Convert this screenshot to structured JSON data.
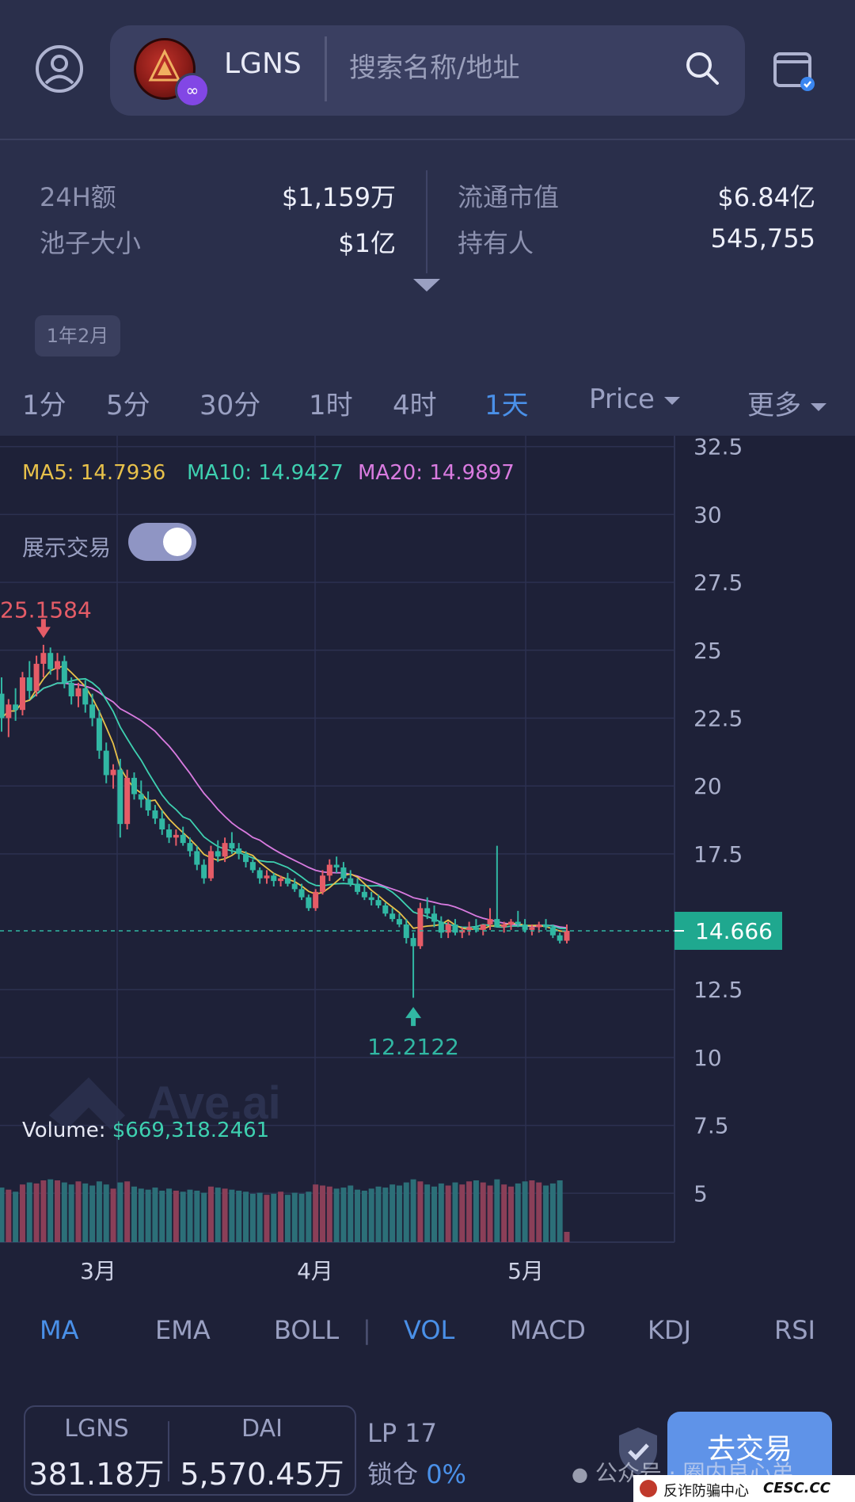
{
  "header": {
    "token_symbol": "LGNS",
    "search_placeholder": "搜索名称/地址",
    "chain_badge": "∞"
  },
  "stats": {
    "vol24h_label": "24H额",
    "vol24h_value": "$1,159万",
    "pool_label": "池子大小",
    "pool_value": "$1亿",
    "mcap_label": "流通市值",
    "mcap_value": "$6.84亿",
    "holders_label": "持有人",
    "holders_value": "545,755"
  },
  "range_chip": "1年2月",
  "timeframes": [
    "1分",
    "5分",
    "30分",
    "1时",
    "4时",
    "1天"
  ],
  "active_timeframe": "1天",
  "price_dropdown": "Price",
  "more_dropdown": "更多",
  "ma": {
    "ma5_label": "MA5:",
    "ma5_value": "14.7936",
    "ma10_label": "MA10:",
    "ma10_value": "14.9427",
    "ma20_label": "MA20:",
    "ma20_value": "14.9897",
    "colors": {
      "ma5": "#e8c14a",
      "ma10": "#3ed0b0",
      "ma20": "#d97be0"
    }
  },
  "show_trades_label": "展示交易",
  "show_trades_on": true,
  "watermark": "Ave.ai",
  "volume": {
    "label": "Volume:",
    "value": "$669,318.2461"
  },
  "chart_data": {
    "type": "candlestick",
    "y_ticks": [
      "32.5",
      "30",
      "27.5",
      "25",
      "22.5",
      "20",
      "17.5",
      "14.666",
      "12.5",
      "10",
      "7.5",
      "5"
    ],
    "ylim": [
      3.2,
      32.9
    ],
    "x_ticks": [
      "3月",
      "4月",
      "5月"
    ],
    "current_price": "14.666",
    "high_marker": "25.1584",
    "low_marker": "12.2122",
    "ohlc": [
      [
        23.4,
        24.0,
        22.0,
        22.5
      ],
      [
        22.5,
        23.2,
        21.8,
        23.0
      ],
      [
        23.0,
        23.6,
        22.4,
        22.8
      ],
      [
        22.8,
        24.2,
        22.6,
        24.0
      ],
      [
        24.0,
        24.6,
        23.2,
        23.5
      ],
      [
        23.5,
        24.8,
        23.3,
        24.5
      ],
      [
        24.5,
        25.2,
        24.0,
        24.9
      ],
      [
        24.9,
        25.1,
        24.1,
        24.3
      ],
      [
        24.3,
        24.9,
        23.9,
        24.6
      ],
      [
        24.6,
        24.8,
        23.6,
        23.8
      ],
      [
        23.8,
        24.0,
        23.0,
        23.3
      ],
      [
        23.3,
        23.8,
        22.9,
        23.6
      ],
      [
        23.6,
        23.9,
        22.7,
        23.0
      ],
      [
        23.0,
        23.4,
        22.2,
        22.5
      ],
      [
        22.5,
        22.8,
        21.0,
        21.3
      ],
      [
        21.3,
        21.6,
        20.1,
        20.4
      ],
      [
        20.4,
        20.8,
        19.9,
        20.6
      ],
      [
        20.6,
        21.0,
        18.1,
        18.6
      ],
      [
        18.6,
        20.6,
        18.4,
        20.3
      ],
      [
        20.3,
        20.5,
        19.5,
        19.7
      ],
      [
        19.7,
        20.2,
        19.2,
        19.5
      ],
      [
        19.5,
        19.8,
        18.9,
        19.1
      ],
      [
        19.1,
        19.3,
        18.6,
        18.8
      ],
      [
        18.8,
        19.1,
        18.2,
        18.4
      ],
      [
        18.4,
        18.6,
        17.9,
        18.1
      ],
      [
        18.1,
        18.4,
        17.8,
        18.2
      ],
      [
        18.2,
        18.5,
        17.8,
        17.9
      ],
      [
        17.9,
        18.1,
        17.4,
        17.6
      ],
      [
        17.6,
        17.8,
        16.9,
        17.1
      ],
      [
        17.1,
        17.3,
        16.4,
        16.6
      ],
      [
        16.6,
        17.8,
        16.5,
        17.6
      ],
      [
        17.6,
        18.0,
        17.2,
        17.4
      ],
      [
        17.4,
        18.1,
        17.2,
        17.9
      ],
      [
        17.9,
        18.3,
        17.5,
        17.7
      ],
      [
        17.7,
        17.9,
        17.3,
        17.5
      ],
      [
        17.5,
        17.6,
        17.0,
        17.2
      ],
      [
        17.2,
        17.3,
        16.8,
        16.9
      ],
      [
        16.9,
        17.0,
        16.4,
        16.6
      ],
      [
        16.6,
        16.9,
        16.4,
        16.7
      ],
      [
        16.7,
        16.8,
        16.3,
        16.5
      ],
      [
        16.5,
        16.7,
        16.3,
        16.6
      ],
      [
        16.6,
        16.8,
        16.3,
        16.4
      ],
      [
        16.4,
        16.6,
        16.1,
        16.2
      ],
      [
        16.2,
        16.4,
        15.8,
        15.9
      ],
      [
        15.9,
        16.0,
        15.4,
        15.5
      ],
      [
        15.5,
        16.2,
        15.4,
        16.1
      ],
      [
        16.1,
        16.9,
        16.0,
        16.7
      ],
      [
        16.7,
        17.3,
        16.5,
        17.1
      ],
      [
        17.1,
        17.4,
        16.8,
        17.0
      ],
      [
        17.0,
        17.2,
        16.5,
        16.6
      ],
      [
        16.6,
        16.9,
        16.3,
        16.4
      ],
      [
        16.4,
        16.6,
        16.0,
        16.1
      ],
      [
        16.1,
        16.3,
        15.8,
        15.9
      ],
      [
        15.9,
        16.1,
        15.6,
        15.8
      ],
      [
        15.8,
        16.0,
        15.5,
        15.6
      ],
      [
        15.6,
        15.7,
        15.2,
        15.3
      ],
      [
        15.3,
        15.5,
        15.0,
        15.1
      ],
      [
        15.1,
        15.3,
        14.8,
        14.9
      ],
      [
        14.9,
        15.1,
        14.2,
        14.4
      ],
      [
        14.4,
        14.6,
        12.2,
        14.1
      ],
      [
        14.1,
        15.7,
        14.0,
        15.5
      ],
      [
        15.5,
        15.9,
        15.1,
        15.3
      ],
      [
        15.3,
        15.6,
        14.8,
        15.0
      ],
      [
        15.0,
        15.2,
        14.4,
        14.6
      ],
      [
        14.6,
        15.0,
        14.4,
        14.9
      ],
      [
        14.9,
        15.1,
        14.5,
        14.6
      ],
      [
        14.6,
        14.8,
        14.4,
        14.7
      ],
      [
        14.7,
        15.0,
        14.5,
        14.8
      ],
      [
        14.8,
        15.1,
        14.6,
        14.7
      ],
      [
        14.7,
        14.9,
        14.5,
        14.9
      ],
      [
        14.9,
        15.5,
        14.7,
        15.1
      ],
      [
        15.1,
        17.8,
        14.8,
        14.8
      ],
      [
        14.8,
        15.0,
        14.6,
        14.9
      ],
      [
        14.9,
        15.1,
        14.7,
        15.0
      ],
      [
        15.0,
        15.4,
        14.8,
        14.9
      ],
      [
        14.9,
        15.1,
        14.6,
        14.7
      ],
      [
        14.7,
        14.9,
        14.5,
        14.8
      ],
      [
        14.8,
        15.0,
        14.6,
        14.9
      ],
      [
        14.9,
        15.1,
        14.7,
        14.8
      ],
      [
        14.8,
        14.9,
        14.4,
        14.5
      ],
      [
        14.5,
        14.6,
        14.2,
        14.3
      ],
      [
        14.3,
        14.9,
        14.2,
        14.666
      ]
    ],
    "ma5": [],
    "volume": [
      5.3,
      5.1,
      4.9,
      5.6,
      5.8,
      5.7,
      6.0,
      6.1,
      6.0,
      5.8,
      5.6,
      5.9,
      5.7,
      5.5,
      5.9,
      5.6,
      5.2,
      5.8,
      5.9,
      5.4,
      5.2,
      5.1,
      5.3,
      5.0,
      5.2,
      5.0,
      4.9,
      5.1,
      5.0,
      4.8,
      5.4,
      5.3,
      5.2,
      5.1,
      5.0,
      4.9,
      4.7,
      4.8,
      4.6,
      4.7,
      4.9,
      4.6,
      4.8,
      4.7,
      4.9,
      5.6,
      5.5,
      5.4,
      5.2,
      5.3,
      5.5,
      5.1,
      5.0,
      5.2,
      5.4,
      5.3,
      5.6,
      5.5,
      5.8,
      6.1,
      5.9,
      5.6,
      5.4,
      5.7,
      5.5,
      5.8,
      5.6,
      5.9,
      6.0,
      5.8,
      5.5,
      6.1,
      5.6,
      5.4,
      5.7,
      5.9,
      6.0,
      5.8,
      5.5,
      5.7,
      6.0,
      1.0
    ]
  },
  "indicators": [
    "MA",
    "EMA",
    "BOLL",
    "VOL",
    "MACD",
    "KDJ",
    "RSI"
  ],
  "indicator_separator": "|",
  "active_indicators": [
    "MA",
    "VOL"
  ],
  "liquidity": {
    "base_symbol": "LGNS",
    "base_amount": "381.18万",
    "quote_symbol": "DAI",
    "quote_amount": "5,570.45万",
    "lp_label": "LP 17",
    "lock_label": "锁仓",
    "lock_value": "0%"
  },
  "trade_button": "去交易",
  "overlay": {
    "wechat_text": "公众号 · 圈内良心弟",
    "footer_text": "反诈防骗中心",
    "footer_domain": "CESC.CC"
  }
}
